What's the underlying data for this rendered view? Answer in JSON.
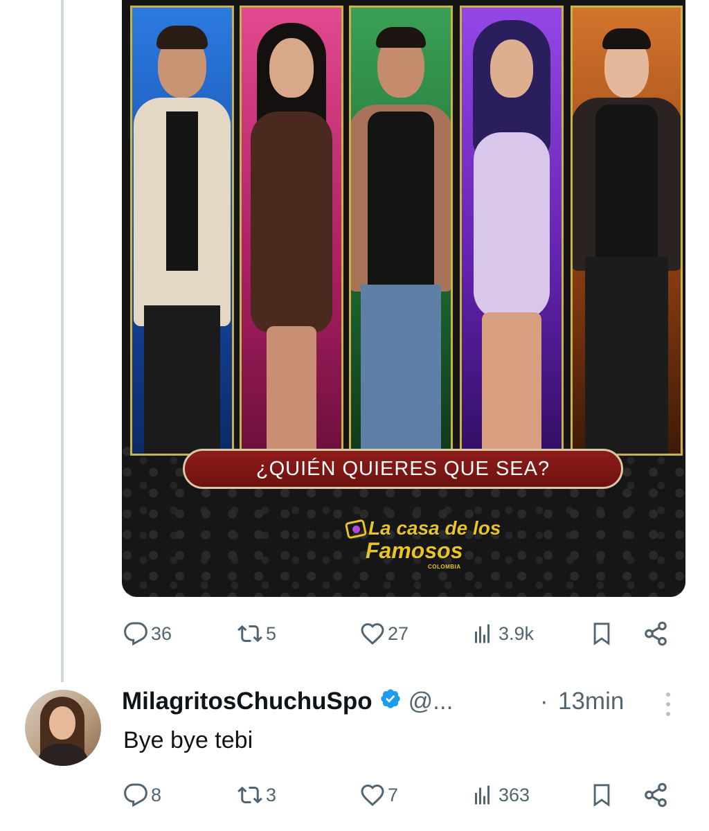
{
  "media": {
    "banner_text": "¿QUIÉN QUIERES QUE SEA?",
    "logo": {
      "line1": "La casa de los",
      "line2": "Famosos",
      "line3": "COLOMBIA"
    },
    "panel_colors": [
      "#1f63c9",
      "#d9347a",
      "#2e8f3f",
      "#7a2bd3",
      "#c4631d"
    ]
  },
  "tweet_actions": {
    "replies": "36",
    "retweets": "5",
    "likes": "27",
    "views": "3.9k"
  },
  "reply": {
    "name": "MilagritosChuchuSpo",
    "handle": "@...",
    "separator": "·",
    "time": "13min",
    "text": "Bye bye tebi",
    "actions": {
      "replies": "8",
      "retweets": "3",
      "likes": "7",
      "views": "363"
    }
  },
  "icons": [
    "reply-icon",
    "retweet-icon",
    "like-icon",
    "views-icon",
    "bookmark-icon",
    "share-icon",
    "verified-badge-icon",
    "more-icon"
  ],
  "colors": {
    "text": "#0f1419",
    "muted": "#536471",
    "verified": "#1d9bf0",
    "banner": "#8e1d1b",
    "logo": "#e8c521"
  }
}
